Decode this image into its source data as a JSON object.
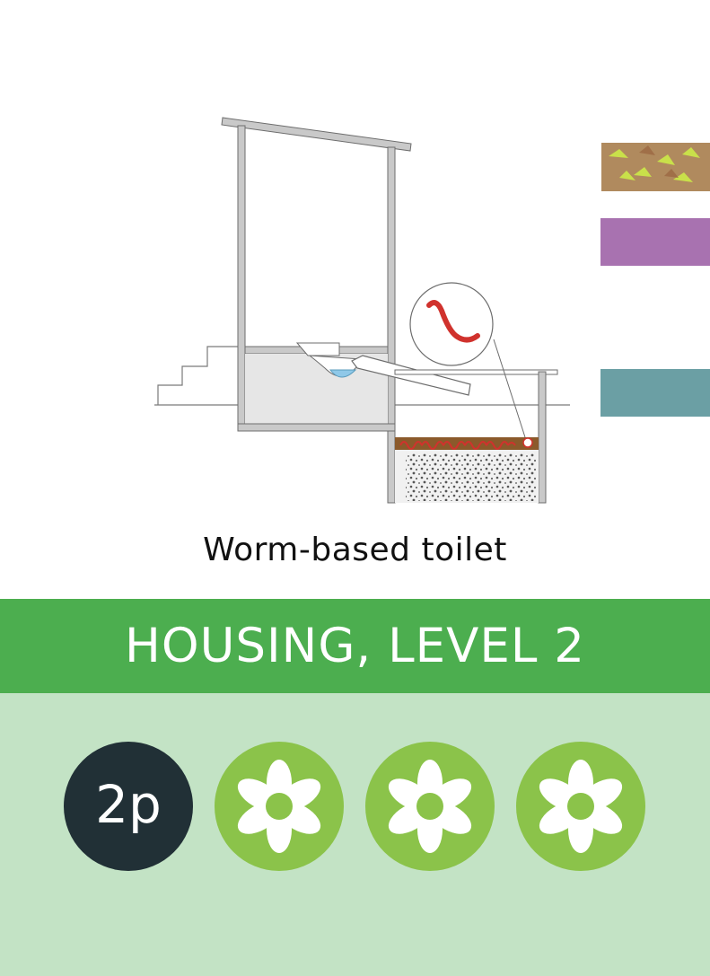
{
  "caption": "Worm-based toilet",
  "banner": {
    "title": "HOUSING, LEVEL 2"
  },
  "cost_token": {
    "label": "2p"
  },
  "flower_tokens": [
    {
      "icon": "flower-icon"
    },
    {
      "icon": "flower-icon"
    },
    {
      "icon": "flower-icon"
    }
  ],
  "colors": {
    "banner": "#4cae4f",
    "lower_panel": "#c3e3c5",
    "cost_token": "#213036",
    "flower_token": "#8bc34a",
    "swatch_soil": "#b08a5e",
    "swatch_purple": "#a872b0",
    "swatch_teal": "#6b9fa4",
    "worm": "#d0322d"
  }
}
